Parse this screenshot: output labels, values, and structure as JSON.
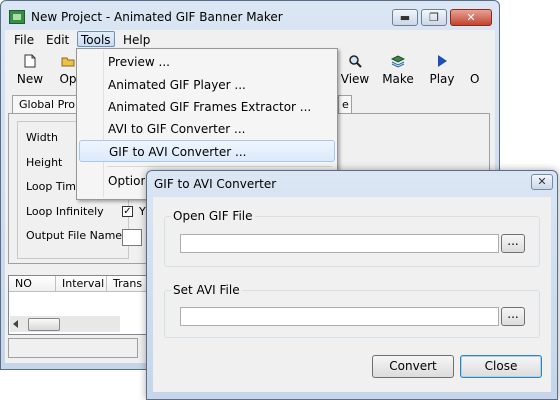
{
  "window": {
    "title": "New Project - Animated GIF Banner Maker",
    "controls": {
      "minimize": "▬",
      "maximize": "❐",
      "close": "✕"
    }
  },
  "menubar": {
    "items": [
      "File",
      "Edit",
      "Tools",
      "Help"
    ],
    "active": "Tools"
  },
  "toolbar": {
    "new": "New",
    "open_partial": "Op",
    "view": "View",
    "make": "Make",
    "play": "Play",
    "right_partial": "O"
  },
  "tabs": {
    "global_partial": "Global Prope",
    "right_partial": "e"
  },
  "properties": {
    "width": "Width",
    "height": "Height",
    "loop_time_partial": "Loop Time",
    "loop_infinitely": "Loop Infinitely",
    "checkbox_glyph": "✓",
    "checkbox_label_partial": "Y",
    "output_file_name": "Output File Name"
  },
  "frames_list": {
    "columns": [
      "NO",
      "Interval",
      "Trans"
    ]
  },
  "tools_menu": {
    "items": [
      "Preview ...",
      "Animated GIF Player ...",
      "Animated GIF Frames Extractor ...",
      "AVI to GIF Converter ...",
      "GIF to AVI Converter ..."
    ],
    "highlighted": "GIF to AVI Converter ...",
    "option_partial": "Option"
  },
  "dialog": {
    "title": "GIF to AVI Converter",
    "close_glyph": "✕",
    "open_gif_label": "Open GIF File",
    "open_gif_value": "",
    "set_avi_label": "Set AVI File",
    "set_avi_value": "",
    "browse_label": "...",
    "convert_label": "Convert",
    "close_label": "Close"
  },
  "colors": {
    "title_bar": "#c6d5ea",
    "menu_highlight": "#dceafb",
    "close_red": "#c24330"
  }
}
